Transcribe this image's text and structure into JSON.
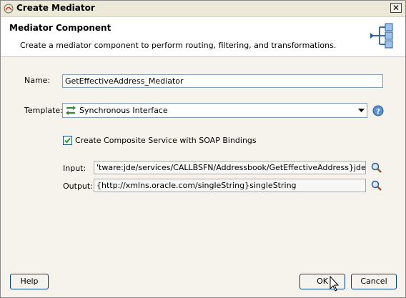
{
  "window": {
    "title": "Create Mediator",
    "close_glyph": "✕"
  },
  "header": {
    "title": "Mediator Component",
    "description": "Create a mediator component to perform routing, filtering, and transformations.",
    "icon": "mediator-component-icon"
  },
  "form": {
    "name_label": "Name:",
    "name_value": "GetEffectiveAddress_Mediator",
    "template_label": "Template:",
    "template_value": "Synchronous Interface",
    "template_icon": "synchronous-interface-icon",
    "checkbox_label": "Create Composite Service with SOAP Bindings",
    "checkbox_checked": true,
    "input_label": "Input:",
    "input_value": "'tware:jde/services/CALLBSFN/Addressbook/GetEffectiveAddress}jdeRequest",
    "output_label": "Output:",
    "output_value": "{http://xmlns.oracle.com/singleString}singleString"
  },
  "footer": {
    "help_label": "Help",
    "ok_label": "OK",
    "cancel_label": "Cancel"
  },
  "colors": {
    "dialog_bg": "#f5f3ec",
    "header_bg": "#ffffff",
    "input_border": "#7f9db9",
    "button_border": "#003c74"
  }
}
